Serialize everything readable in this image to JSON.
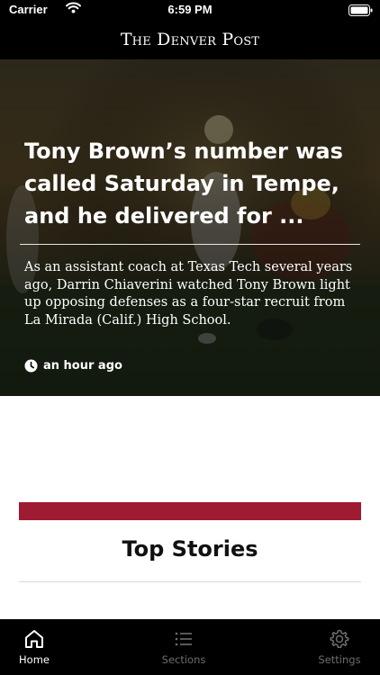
{
  "status_bar": {
    "carrier": "Carrier",
    "time": "6:59 PM"
  },
  "masthead": {
    "title": "The Denver Post"
  },
  "hero": {
    "title": "Tony Brown’s number was called Saturday in Tempe, and he delivered for ...",
    "summary": "As an assistant coach at Texas Tech several years ago, Darrin Chiaverini watched Tony Brown light up opposing defenses as a four-star recruit from La Mirada (Calif.) High School.",
    "time_ago": "an hour ago",
    "time_icon": "clock-icon"
  },
  "section": {
    "accent_color": "#9e1b32",
    "title": "Top Stories"
  },
  "tabs": [
    {
      "label": "Home",
      "icon": "home-icon",
      "active": true
    },
    {
      "label": "Sections",
      "icon": "list-icon",
      "active": false
    },
    {
      "label": "Settings",
      "icon": "gear-icon",
      "active": false
    }
  ]
}
